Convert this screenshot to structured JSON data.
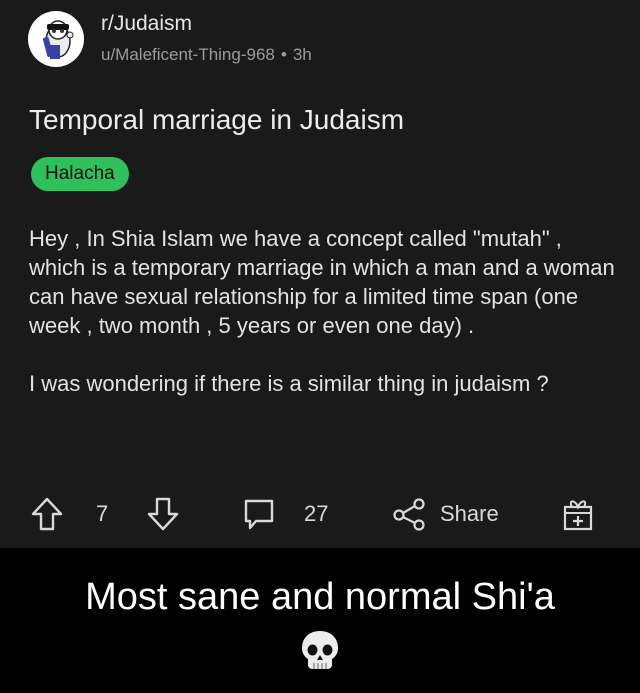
{
  "post": {
    "subreddit": "r/Judaism",
    "author": "u/Maleficent-Thing-968",
    "separator": "•",
    "age": "3h",
    "title": "Temporal marriage in Judaism",
    "flair": "Halacha",
    "body": [
      "Hey , In Shia Islam we have a concept called \"mutah\" , which is a temporary marriage in which a man and a woman can have sexual relationship for a limited time span (one week , two month , 5 years or even one day) .",
      "I was wondering if there is a similar thing in judaism ?"
    ]
  },
  "actions": {
    "upvote_icon": "arrow-up-icon",
    "vote_count": "7",
    "downvote_icon": "arrow-down-icon",
    "comment_icon": "comment-bubble-icon",
    "comment_count": "27",
    "share_icon": "share-icon",
    "share_label": "Share",
    "award_icon": "gift-box-icon"
  },
  "caption": {
    "text": "Most sane and normal Shi'a",
    "emoji_icon": "skull-icon"
  },
  "colors": {
    "post_background": "#1a1a1b",
    "page_background": "#000000",
    "flair_background": "#2ec15b",
    "text": "#d7dadc",
    "muted_text": "#9a9c9e"
  }
}
